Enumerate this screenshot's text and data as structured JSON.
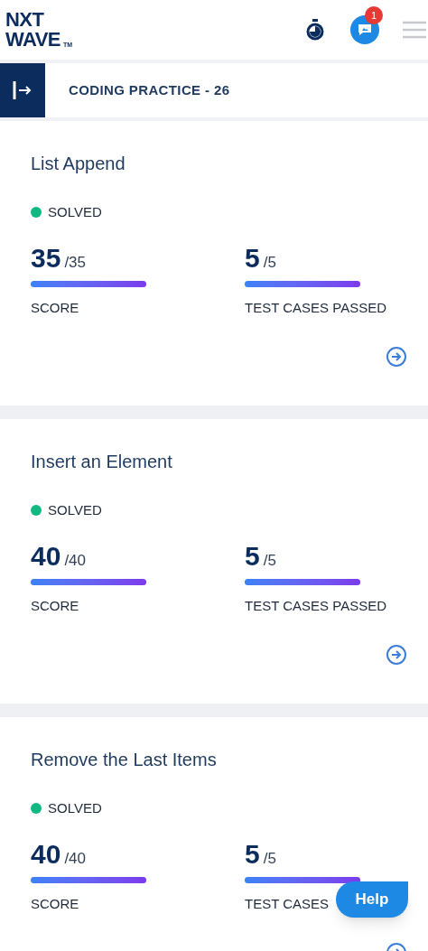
{
  "logo": {
    "line_1": "NXT",
    "line_2": "WAVE",
    "mark": "TM"
  },
  "header": {
    "notification_count": "1"
  },
  "page_title": "CODING PRACTICE - 26",
  "cards": [
    {
      "title": "List Append",
      "status": "SOLVED",
      "solved": true,
      "metrics": [
        {
          "value": "35",
          "total": "/35",
          "label": "SCORE",
          "level": 1
        },
        {
          "value": "5",
          "total": "/5",
          "label": "TEST CASES PASSED",
          "level": 1
        }
      ]
    },
    {
      "title": "Insert an Element",
      "status": "SOLVED",
      "solved": true,
      "metrics": [
        {
          "value": "40",
          "total": "/40",
          "label": "SCORE",
          "level": 1
        },
        {
          "value": "5",
          "total": "/5",
          "label": "TEST CASES PASSED",
          "level": 1
        }
      ]
    },
    {
      "title": "Remove the Last Items",
      "status": "SOLVED",
      "solved": true,
      "metrics": [
        {
          "value": "40",
          "total": "/40",
          "label": "SCORE",
          "level": 1
        },
        {
          "value": "5",
          "total": "/5",
          "label": "TEST CASES",
          "level": 1
        }
      ]
    }
  ],
  "help_button": "Help"
}
